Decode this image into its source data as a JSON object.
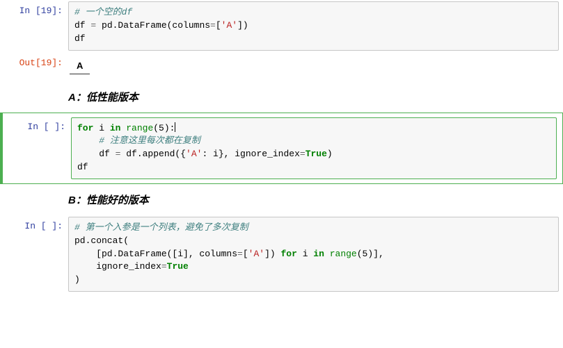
{
  "cell1": {
    "in_prompt": "In [19]:",
    "code": {
      "comment": "# 一个空的df",
      "line2_lhs": "df ",
      "line2_eq": "= ",
      "line2_rhs1": "pd.DataFrame(columns",
      "line2_eq2": "=",
      "line2_lbrack": "[",
      "line2_str": "'A'",
      "line2_rbrack": "])",
      "line3": "df"
    }
  },
  "out1": {
    "out_prompt": "Out[19]:",
    "table_col": "A"
  },
  "heading_a": "A：低性能版本",
  "cell2": {
    "in_prompt": "In [ ]:",
    "code": {
      "kw_for": "for",
      "var_i": " i ",
      "kw_in": "in",
      "sp": " ",
      "range_call": "range",
      "args5": "(5):",
      "comment": "    # 注意这里每次都在复制",
      "line3_lhs": "    df ",
      "line3_eq": "= ",
      "line3_mid": "df.append({",
      "line3_key": "'A'",
      "line3_colon": ": i}, ignore_index",
      "line3_eq2": "=",
      "kw_true": "True",
      "line3_close": ")",
      "line4": "df"
    }
  },
  "heading_b": "B：性能好的版本",
  "cell3": {
    "in_prompt": "In [ ]:",
    "code": {
      "comment": "# 第一个入参是一个列表，避免了多次复制",
      "l2": "pd.concat(",
      "l3_pre": "    [pd.DataFrame([i], columns",
      "l3_eq": "=",
      "l3_b1": "[",
      "l3_str": "'A'",
      "l3_b2": "]) ",
      "kw_for": "for",
      "l3_i": " i ",
      "kw_in": "in",
      "sp": " ",
      "range_call": "range",
      "l3_close": "(5)],",
      "l4_pre": "    ignore_index",
      "l4_eq": "=",
      "kw_true": "True",
      "l5": ")"
    }
  },
  "chart_data": null
}
